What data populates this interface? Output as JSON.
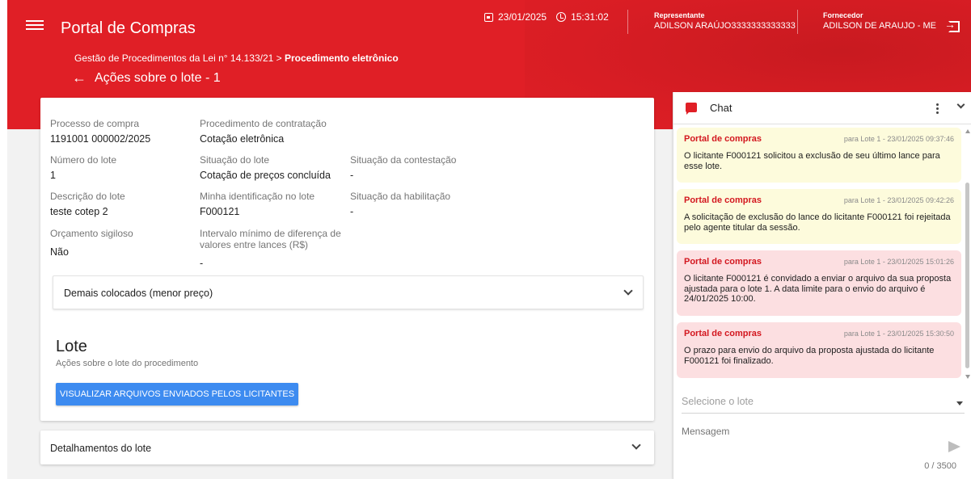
{
  "header": {
    "app_title": "Portal de Compras",
    "date": "23/01/2025",
    "time": "15:31:02",
    "representante_label": "Representante",
    "representante_value": "ADILSON ARAÚJO3333333333333",
    "fornecedor_label": "Fornecedor",
    "fornecedor_value": "ADILSON DE ARAUJO - ME",
    "breadcrumb_base": "Gestão de Procedimentos da Lei n° 14.133/21 > ",
    "breadcrumb_current": "Procedimento eletrônico",
    "page_title": "Ações sobre o lote - 1",
    "accent_color": "#e01f26"
  },
  "details": {
    "processo_label": "Processo de compra",
    "processo_value": "1191001 000002/2025",
    "procedimento_label": "Procedimento de contratação",
    "procedimento_value": "Cotação eletrônica",
    "numero_label": "Número do lote",
    "numero_value": "1",
    "situacao_lote_label": "Situação do lote",
    "situacao_lote_value": "Cotação de preços concluída",
    "contestacao_label": "Situação da contestação",
    "contestacao_value": "-",
    "descricao_label": "Descrição do lote",
    "descricao_value": "teste cotep 2",
    "identificacao_label": "Minha identificação no lote",
    "identificacao_value": "F000121",
    "habilitacao_label": "Situação da habilitação",
    "habilitacao_value": "-",
    "orcamento_label": "Orçamento sigiloso",
    "orcamento_value": "Não",
    "intervalo_label_1": "Intervalo mínimo de diferença de",
    "intervalo_label_2": "valores entre lances (R$)",
    "intervalo_value": "-"
  },
  "demais": {
    "label": "Demais colocados (menor preço)"
  },
  "lote": {
    "title": "Lote",
    "subtitle": "Ações sobre o lote do procedimento",
    "button_label": "VISUALIZAR ARQUIVOS ENVIADOS PELOS LICITANTES"
  },
  "detalhamentos": {
    "label": "Detalhamentos do lote"
  },
  "chat": {
    "title": "Chat",
    "messages": [
      {
        "from": "Portal de compras",
        "meta": "para Lote 1 - 23/01/2025 09:37:46",
        "text": "O licitante F000121 solicitou a exclusão de seu último lance para esse lote.",
        "color": "#fdfbdc"
      },
      {
        "from": "Portal de compras",
        "meta": "para Lote 1 - 23/01/2025 09:42:26",
        "text": "A solicitação de exclusão do lance do licitante F000121 foi rejeitada pelo agente titular da sessão.",
        "color": "#fdfbdc"
      },
      {
        "from": "Portal de compras",
        "meta": "para Lote 1 - 23/01/2025 15:01:26",
        "text": "O licitante F000121 é convidado a enviar o arquivo da sua proposta ajustada para o lote  1. A data limite para o envio do arquivo é 24/01/2025 10:00.",
        "color": "#fcdfe1"
      },
      {
        "from": "Portal de compras",
        "meta": "para Lote 1 - 23/01/2025 15:30:50",
        "text": "O prazo para envio do arquivo da proposta ajustada do licitante F000121 foi finalizado.",
        "color": "#fcdfe1"
      }
    ],
    "select_placeholder": "Selecione o lote",
    "message_placeholder": "Mensagem",
    "counter": "0 / 3500"
  }
}
